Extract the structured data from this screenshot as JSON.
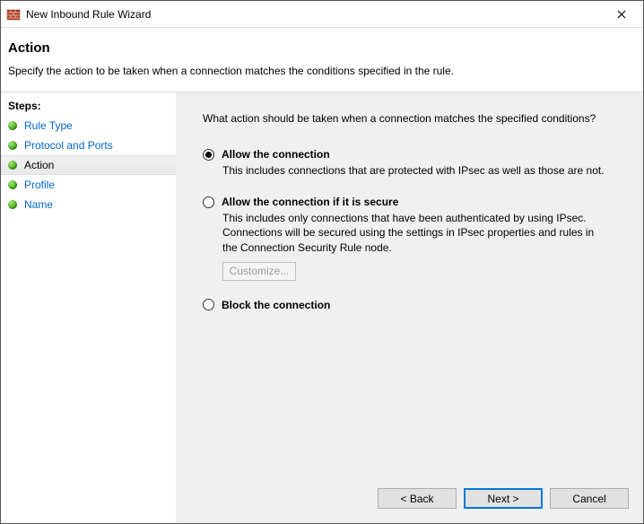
{
  "window": {
    "title": "New Inbound Rule Wizard",
    "close_label": "✕"
  },
  "header": {
    "title": "Action",
    "subtitle": "Specify the action to be taken when a connection matches the conditions specified in the rule."
  },
  "sidebar": {
    "title": "Steps:",
    "steps": [
      {
        "label": "Rule Type",
        "current": false
      },
      {
        "label": "Protocol and Ports",
        "current": false
      },
      {
        "label": "Action",
        "current": true
      },
      {
        "label": "Profile",
        "current": false
      },
      {
        "label": "Name",
        "current": false
      }
    ]
  },
  "content": {
    "prompt": "What action should be taken when a connection matches the specified conditions?",
    "options": {
      "allow": {
        "label": "Allow the connection",
        "desc": "This includes connections that are protected with IPsec as well as those are not."
      },
      "allow_secure": {
        "label": "Allow the connection if it is secure",
        "desc": "This includes only connections that have been authenticated by using IPsec.  Connections will be secured using the settings in IPsec properties and rules in the Connection Security Rule node.",
        "customize_label": "Customize..."
      },
      "block": {
        "label": "Block the connection"
      }
    },
    "selected": "allow"
  },
  "footer": {
    "back": "< Back",
    "next": "Next >",
    "cancel": "Cancel"
  }
}
